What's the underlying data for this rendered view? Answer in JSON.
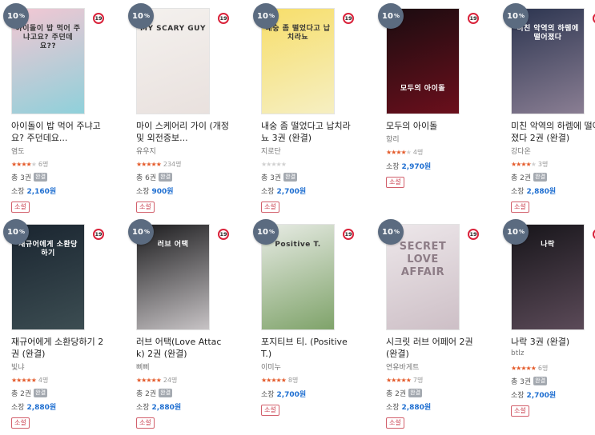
{
  "discount_suffix": "%",
  "volume_prefix": "총",
  "price_prefix": "소장",
  "books": [
    {
      "discount": "10",
      "age": "19",
      "cover_text": "아이돌이 밥 먹어 주냐고요? 주던데요??",
      "title": "아이돌이 밥 먹어 주냐고요? 주던데요...",
      "author": "염도",
      "rating_stars": 3.5,
      "rating_count": "6명",
      "volumes": "3권",
      "completed": "완결",
      "price": "2,160원",
      "genre": "소설",
      "cover_colors": [
        "#f3c7d3",
        "#8fd0da"
      ]
    },
    {
      "discount": "10",
      "age": "19",
      "cover_text": "MY SCARY GUY",
      "title": "마이 스케어리 가이 (개정 및 외전증보...",
      "author": "유우지",
      "rating_stars": 5,
      "rating_count": "234명",
      "volumes": "6권",
      "completed": "완결",
      "price": "900원",
      "genre": "소설",
      "cover_colors": [
        "#f4f1ee",
        "#e9e1de"
      ]
    },
    {
      "discount": "10",
      "age": "19",
      "cover_text": "내숭 좀 떨었다고 납치라뇨",
      "title": "내숭 좀 떨었다고 납치라뇨 3권 (완결)",
      "author": "지로단",
      "rating_stars": 0,
      "rating_count": "",
      "volumes": "3권",
      "completed": "완결",
      "price": "2,700원",
      "genre": "소설",
      "cover_colors": [
        "#f7de6a",
        "#f6efc2"
      ]
    },
    {
      "discount": "10",
      "age": "19",
      "cover_text": "모두의 아이돌",
      "title": "모두의 아이돌",
      "author": "항리",
      "rating_stars": 4,
      "rating_count": "4명",
      "volumes": "",
      "completed": "",
      "price": "2,970원",
      "genre": "소설",
      "cover_colors": [
        "#1a0c10",
        "#6b0f1c"
      ]
    },
    {
      "discount": "10",
      "age": "19",
      "cover_text": "미친 악역의 하렘에 떨어졌다",
      "title": "미친 악역의 하렘에 떨어졌다 2권 (완결)",
      "author": "강다온",
      "rating_stars": 3.5,
      "rating_count": "3명",
      "volumes": "2권",
      "completed": "완결",
      "price": "2,880원",
      "genre": "소설",
      "cover_colors": [
        "#2c3550",
        "#8a7e93"
      ]
    },
    {
      "discount": "10",
      "age": "19",
      "cover_text": "재규어에게 소환당하기",
      "title": "재규어에게 소환당하기 2권 (완결)",
      "author": "빛냐",
      "rating_stars": 5,
      "rating_count": "4명",
      "volumes": "2권",
      "completed": "완결",
      "price": "2,880원",
      "genre": "소설",
      "cover_colors": [
        "#1a2530",
        "#3c4d52"
      ]
    },
    {
      "discount": "10",
      "age": "19",
      "cover_text": "러브 어택",
      "title": "러브 어택(Love Attack) 2권 (완결)",
      "author": "삐삐",
      "rating_stars": 5,
      "rating_count": "24명",
      "volumes": "2권",
      "completed": "완결",
      "price": "2,880원",
      "genre": "소설",
      "cover_colors": [
        "#1c1c1e",
        "#c7c3c5"
      ]
    },
    {
      "discount": "10",
      "age": "19",
      "cover_text": "Positive T.",
      "title": "포지티브 티. (Positive T.)",
      "author": "이미누",
      "rating_stars": 5,
      "rating_count": "8명",
      "volumes": "",
      "completed": "",
      "price": "2,700원",
      "genre": "소설",
      "cover_colors": [
        "#e7ebe4",
        "#7fa36a"
      ]
    },
    {
      "discount": "10",
      "age": "19",
      "cover_text": "SECRET LOVE AFFAIR",
      "title": "시크릿 러브 어페어 2권 (완결)",
      "author": "연유바게트",
      "rating_stars": 5,
      "rating_count": "7명",
      "volumes": "2권",
      "completed": "완결",
      "price": "2,880원",
      "genre": "소설",
      "cover_colors": [
        "#ede7ea",
        "#cdbfc6"
      ]
    },
    {
      "discount": "10",
      "age": "19",
      "cover_text": "나락",
      "title": "나락 3권 (완결)",
      "author": "btlz",
      "rating_stars": 5,
      "rating_count": "6명",
      "volumes": "3권",
      "completed": "완결",
      "price": "2,700원",
      "genre": "소설",
      "cover_colors": [
        "#17151a",
        "#5b4a58"
      ]
    }
  ]
}
